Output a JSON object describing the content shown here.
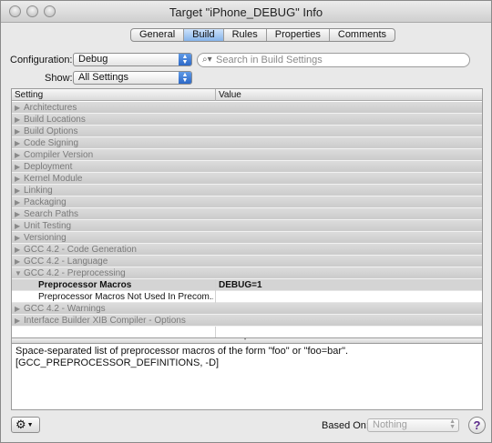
{
  "window": {
    "title": "Target \"iPhone_DEBUG\" Info"
  },
  "tabs": [
    {
      "label": "General",
      "active": false
    },
    {
      "label": "Build",
      "active": true
    },
    {
      "label": "Rules",
      "active": false
    },
    {
      "label": "Properties",
      "active": false
    },
    {
      "label": "Comments",
      "active": false
    }
  ],
  "configuration": {
    "label": "Configuration:",
    "value": "Debug"
  },
  "show": {
    "label": "Show:",
    "value": "All Settings"
  },
  "search": {
    "placeholder": "Search in Build Settings",
    "icon": "magnifier-icon"
  },
  "table": {
    "headers": {
      "setting": "Setting",
      "value": "Value"
    },
    "rows": [
      {
        "type": "group",
        "label": "Architectures",
        "expanded": false
      },
      {
        "type": "group",
        "label": "Build Locations",
        "expanded": false
      },
      {
        "type": "group",
        "label": "Build Options",
        "expanded": false
      },
      {
        "type": "group",
        "label": "Code Signing",
        "expanded": false
      },
      {
        "type": "group",
        "label": "Compiler Version",
        "expanded": false
      },
      {
        "type": "group",
        "label": "Deployment",
        "expanded": false
      },
      {
        "type": "group",
        "label": "Kernel Module",
        "expanded": false
      },
      {
        "type": "group",
        "label": "Linking",
        "expanded": false
      },
      {
        "type": "group",
        "label": "Packaging",
        "expanded": false
      },
      {
        "type": "group",
        "label": "Search Paths",
        "expanded": false
      },
      {
        "type": "group",
        "label": "Unit Testing",
        "expanded": false
      },
      {
        "type": "group",
        "label": "Versioning",
        "expanded": false
      },
      {
        "type": "group",
        "label": "GCC 4.2 - Code Generation",
        "expanded": false
      },
      {
        "type": "group",
        "label": "GCC 4.2 - Language",
        "expanded": false
      },
      {
        "type": "group",
        "label": "GCC 4.2 - Preprocessing",
        "expanded": true
      },
      {
        "type": "setting",
        "label": "Preprocessor Macros",
        "value": "DEBUG=1",
        "bold": true,
        "selected": true
      },
      {
        "type": "setting",
        "label": "Preprocessor Macros Not Used In Precom...",
        "value": "",
        "bold": false,
        "selected": false
      },
      {
        "type": "group",
        "label": "GCC 4.2 - Warnings",
        "expanded": false
      },
      {
        "type": "group",
        "label": "Interface Builder XIB Compiler - Options",
        "expanded": false
      },
      {
        "type": "setting",
        "label": "",
        "value": "",
        "bold": false,
        "selected": false
      }
    ]
  },
  "description": {
    "line1": "Space-separated list of preprocessor macros of the form \"foo\" or \"foo=bar\".",
    "line2": "[GCC_PREPROCESSOR_DEFINITIONS, -D]"
  },
  "footer": {
    "gear_icon": "gear-icon",
    "based_on_label": "Based On:",
    "based_on_value": "Nothing",
    "help_glyph": "?"
  },
  "colors": {
    "accent": "#86b4ea",
    "popup_arrow": "#2c68c7",
    "group_row": "#d3d3d3"
  }
}
